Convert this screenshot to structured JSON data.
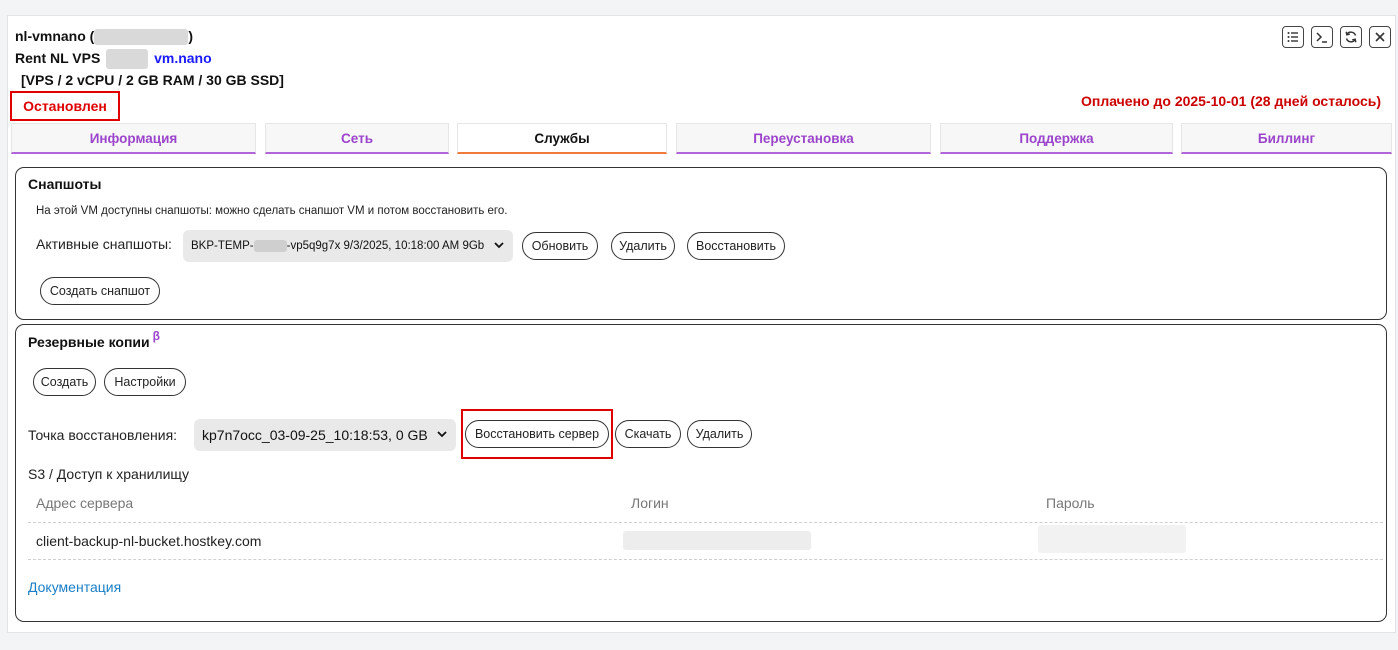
{
  "server": {
    "name_prefix": "nl-vmnano (",
    "name_suffix": ")",
    "plan_prefix": "Rent NL VPS",
    "plan_link": "vm.nano",
    "specs": "[VPS / 2 vCPU / 2 GB RAM / 30 GB SSD]",
    "status": "Остановлен",
    "paid_until": "Оплачено до 2025-10-01 (28 дней осталось)"
  },
  "toolbar": {
    "icons": [
      "list-icon",
      "terminal-icon",
      "refresh-icon",
      "close-icon"
    ]
  },
  "tabs": [
    {
      "label": "Информация",
      "active": false
    },
    {
      "label": "Сеть",
      "active": false
    },
    {
      "label": "Службы",
      "active": true
    },
    {
      "label": "Переустановка",
      "active": false
    },
    {
      "label": "Поддержка",
      "active": false
    },
    {
      "label": "Биллинг",
      "active": false
    }
  ],
  "snapshots": {
    "title": "Снапшоты",
    "description": "На этой VM доступны снапшоты: можно сделать снапшот VM и потом восстановить его.",
    "active_label": "Активные снапшоты:",
    "selected_prefix": "BKP-TEMP-",
    "selected_suffix": "-vp5q9g7x 9/3/2025, 10:18:00 AM 9Gb",
    "refresh_button": "Обновить",
    "delete_button": "Удалить",
    "restore_button": "Восстановить",
    "create_button": "Создать снапшот"
  },
  "backups": {
    "title": "Резервные копии",
    "beta_mark": "β",
    "create_button": "Создать",
    "settings_button": "Настройки",
    "restore_point_label": "Точка восстановления:",
    "restore_point_value": "kp7n7occ_03-09-25_10:18:53, 0 GB",
    "restore_server_button": "Восстановить сервер",
    "download_button": "Скачать",
    "delete_button": "Удалить",
    "s3_title": "S3 / Доступ к хранилищу",
    "columns": [
      "Адрес сервера",
      "Логин",
      "Пароль"
    ],
    "row": {
      "address": "client-backup-nl-bucket.hostkey.com"
    },
    "docs_link": "Документация"
  },
  "colors": {
    "status_red": "#e00000",
    "tab_purple": "#9c44cc",
    "tab_active_orange": "#f07a3c",
    "link_blue": "#1a7fc8"
  }
}
